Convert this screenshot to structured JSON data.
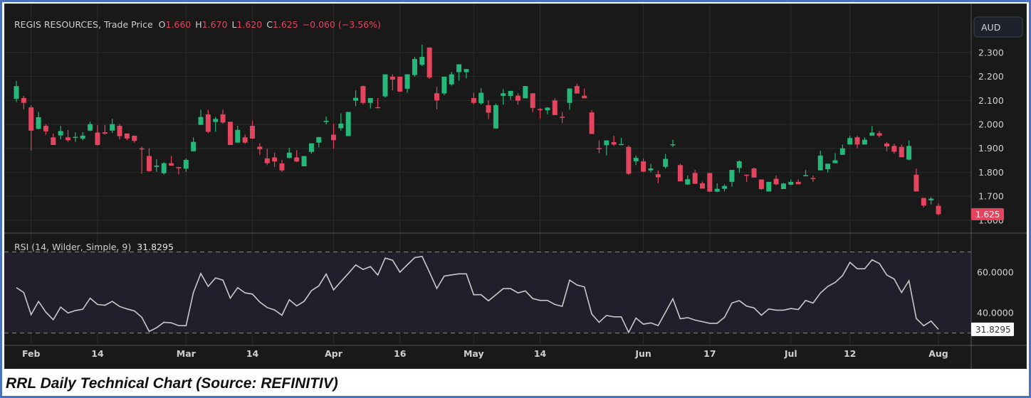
{
  "caption": "RRL Daily Technical Chart (Source: REFINITIV)",
  "colors": {
    "up": "#26b77a",
    "down": "#e4455e",
    "background": "#191919",
    "rsi_band": "#231e2b",
    "rsi_line": "#c9c9c9",
    "grid": "#2b2b2b"
  },
  "chart_data": [
    {
      "type": "candlestick",
      "title": "REGIS RESOURCES, Trade Price",
      "legend": {
        "o_label": "O",
        "o": "1.660",
        "h_label": "H",
        "h": "1.670",
        "l_label": "L",
        "l": "1.620",
        "c_label": "C",
        "c": "1.625",
        "change": "−0.060 (−3.56%)"
      },
      "currency": "AUD",
      "ylim": [
        1.549,
        2.466
      ],
      "yticks": [
        2.3,
        2.2,
        2.1,
        2.0,
        1.9,
        1.8,
        1.7,
        1.6
      ],
      "ytick_labels": [
        "2.300",
        "2.200",
        "2.100",
        "2.000",
        "1.900",
        "1.800",
        "1.700",
        "1.600"
      ],
      "last_price_label": "1.625",
      "x_ticks": [
        {
          "index": 2,
          "label": "Feb"
        },
        {
          "index": 11,
          "label": "14"
        },
        {
          "index": 23,
          "label": "Mar"
        },
        {
          "index": 32,
          "label": "14"
        },
        {
          "index": 43,
          "label": "Apr"
        },
        {
          "index": 52,
          "label": "16"
        },
        {
          "index": 62,
          "label": "May"
        },
        {
          "index": 71,
          "label": "14"
        },
        {
          "index": 85,
          "label": "Jun"
        },
        {
          "index": 94,
          "label": "17"
        },
        {
          "index": 105,
          "label": "Jul"
        },
        {
          "index": 113,
          "label": "12"
        },
        {
          "index": 125,
          "label": "Aug"
        }
      ],
      "ohlc_fields": [
        "open",
        "high",
        "low",
        "close"
      ],
      "ohlc": [
        [
          2.107,
          2.181,
          2.093,
          2.16
        ],
        [
          2.11,
          2.119,
          2.063,
          2.09
        ],
        [
          2.071,
          2.08,
          1.89,
          1.974
        ],
        [
          1.981,
          2.052,
          1.979,
          2.03
        ],
        [
          1.994,
          2.001,
          1.957,
          1.971
        ],
        [
          1.946,
          1.962,
          1.914,
          1.914
        ],
        [
          1.954,
          1.994,
          1.937,
          1.972
        ],
        [
          1.946,
          1.977,
          1.927,
          1.934
        ],
        [
          1.944,
          1.967,
          1.927,
          1.948
        ],
        [
          1.941,
          1.967,
          1.934,
          1.953
        ],
        [
          1.974,
          2.011,
          1.972,
          2.001
        ],
        [
          1.966,
          1.997,
          1.912,
          1.914
        ],
        [
          1.967,
          1.997,
          1.957,
          1.961
        ],
        [
          1.974,
          2.023,
          1.964,
          2.001
        ],
        [
          1.994,
          2.001,
          1.937,
          1.951
        ],
        [
          1.962,
          1.962,
          1.934,
          1.941
        ],
        [
          1.953,
          1.953,
          1.924,
          1.931
        ],
        [
          1.9,
          1.907,
          1.794,
          1.896
        ],
        [
          1.868,
          1.9,
          1.802,
          1.805
        ],
        [
          1.823,
          1.855,
          1.802,
          1.828
        ],
        [
          1.796,
          1.842,
          1.791,
          1.838
        ],
        [
          1.838,
          1.868,
          1.828,
          1.828
        ],
        [
          1.822,
          1.822,
          1.791,
          1.817
        ],
        [
          1.815,
          1.858,
          1.802,
          1.852
        ],
        [
          1.888,
          1.946,
          1.888,
          1.927
        ],
        [
          1.998,
          2.061,
          1.997,
          2.031
        ],
        [
          2.042,
          2.061,
          1.964,
          1.969
        ],
        [
          2.01,
          2.031,
          1.969,
          2.023
        ],
        [
          2.042,
          2.061,
          2.003,
          2.008
        ],
        [
          2.011,
          2.011,
          1.914,
          1.914
        ],
        [
          1.924,
          1.994,
          1.924,
          1.977
        ],
        [
          1.946,
          1.957,
          1.919,
          1.924
        ],
        [
          1.994,
          2.016,
          1.939,
          1.941
        ],
        [
          1.907,
          1.921,
          1.872,
          1.896
        ],
        [
          1.858,
          1.898,
          1.83,
          1.838
        ],
        [
          1.862,
          1.882,
          1.822,
          1.845
        ],
        [
          1.837,
          1.852,
          1.802,
          1.808
        ],
        [
          1.86,
          1.902,
          1.858,
          1.882
        ],
        [
          1.862,
          1.892,
          1.842,
          1.845
        ],
        [
          1.825,
          1.868,
          1.825,
          1.868
        ],
        [
          1.885,
          1.921,
          1.878,
          1.921
        ],
        [
          1.924,
          1.947,
          1.904,
          1.947
        ],
        [
          2.01,
          2.033,
          2.0,
          2.015
        ],
        [
          1.957,
          2.003,
          1.898,
          1.934
        ],
        [
          1.984,
          2.046,
          1.974,
          2.003
        ],
        [
          1.951,
          2.052,
          1.951,
          2.052
        ],
        [
          2.099,
          2.142,
          2.076,
          2.111
        ],
        [
          2.16,
          2.162,
          2.083,
          2.09
        ],
        [
          2.09,
          2.11,
          2.066,
          2.11
        ],
        [
          2.072,
          2.11,
          2.07,
          2.07
        ],
        [
          2.117,
          2.209,
          2.112,
          2.209
        ],
        [
          2.199,
          2.209,
          2.142,
          2.187
        ],
        [
          2.199,
          2.199,
          2.137,
          2.137
        ],
        [
          2.149,
          2.209,
          2.132,
          2.209
        ],
        [
          2.206,
          2.281,
          2.199,
          2.273
        ],
        [
          2.249,
          2.333,
          2.243,
          2.282
        ],
        [
          2.321,
          2.321,
          2.19,
          2.196
        ],
        [
          2.13,
          2.157,
          2.063,
          2.1
        ],
        [
          2.129,
          2.199,
          2.122,
          2.199
        ],
        [
          2.167,
          2.219,
          2.162,
          2.209
        ],
        [
          2.218,
          2.251,
          2.182,
          2.251
        ],
        [
          2.218,
          2.231,
          2.192,
          2.231
        ],
        [
          2.11,
          2.132,
          2.083,
          2.09
        ],
        [
          2.088,
          2.152,
          2.083,
          2.132
        ],
        [
          2.08,
          2.1,
          2.022,
          2.049
        ],
        [
          1.983,
          2.087,
          1.983,
          2.08
        ],
        [
          2.119,
          2.147,
          2.082,
          2.13
        ],
        [
          2.119,
          2.14,
          2.102,
          2.14
        ],
        [
          2.12,
          2.13,
          2.082,
          2.099
        ],
        [
          2.109,
          2.16,
          2.109,
          2.16
        ],
        [
          2.13,
          2.13,
          2.052,
          2.069
        ],
        [
          2.064,
          2.069,
          2.025,
          2.061
        ],
        [
          2.059,
          2.072,
          2.042,
          2.07
        ],
        [
          2.1,
          2.109,
          2.039,
          2.039
        ],
        [
          2.032,
          2.052,
          2.005,
          2.029
        ],
        [
          2.09,
          2.15,
          2.062,
          2.15
        ],
        [
          2.16,
          2.17,
          2.129,
          2.129
        ],
        [
          2.12,
          2.15,
          2.109,
          2.109
        ],
        [
          2.05,
          2.06,
          1.96,
          1.96
        ],
        [
          1.901,
          1.933,
          1.88,
          1.898
        ],
        [
          1.913,
          1.933,
          1.87,
          1.933
        ],
        [
          1.926,
          1.953,
          1.91,
          1.916
        ],
        [
          1.917,
          1.943,
          1.916,
          1.918
        ],
        [
          1.906,
          1.913,
          1.789,
          1.794
        ],
        [
          1.846,
          1.87,
          1.83,
          1.86
        ],
        [
          1.846,
          1.858,
          1.8,
          1.803
        ],
        [
          1.808,
          1.836,
          1.8,
          1.816
        ],
        [
          1.792,
          1.808,
          1.754,
          1.779
        ],
        [
          1.823,
          1.876,
          1.816,
          1.856
        ],
        [
          1.915,
          1.936,
          1.906,
          1.917
        ],
        [
          1.83,
          1.836,
          1.762,
          1.762
        ],
        [
          1.749,
          1.787,
          1.747,
          1.771
        ],
        [
          1.797,
          1.81,
          1.752,
          1.752
        ],
        [
          1.754,
          1.761,
          1.732,
          1.732
        ],
        [
          1.797,
          1.797,
          1.719,
          1.719
        ],
        [
          1.719,
          1.754,
          1.717,
          1.731
        ],
        [
          1.731,
          1.75,
          1.72,
          1.743
        ],
        [
          1.76,
          1.81,
          1.74,
          1.81
        ],
        [
          1.818,
          1.85,
          1.798,
          1.846
        ],
        [
          1.79,
          1.79,
          1.76,
          1.786
        ],
        [
          1.816,
          1.82,
          1.778,
          1.778
        ],
        [
          1.77,
          1.77,
          1.726,
          1.73
        ],
        [
          1.72,
          1.76,
          1.72,
          1.76
        ],
        [
          1.773,
          1.786,
          1.746,
          1.75
        ],
        [
          1.73,
          1.756,
          1.73,
          1.753
        ],
        [
          1.748,
          1.77,
          1.746,
          1.76
        ],
        [
          1.76,
          1.77,
          1.75,
          1.75
        ],
        [
          1.784,
          1.81,
          1.784,
          1.788
        ],
        [
          1.776,
          1.786,
          1.76,
          1.772
        ],
        [
          1.808,
          1.89,
          1.808,
          1.87
        ],
        [
          1.813,
          1.836,
          1.8,
          1.836
        ],
        [
          1.838,
          1.88,
          1.838,
          1.85
        ],
        [
          1.873,
          1.916,
          1.873,
          1.9
        ],
        [
          1.916,
          1.953,
          1.916,
          1.943
        ],
        [
          1.946,
          1.953,
          1.9,
          1.916
        ],
        [
          1.916,
          1.946,
          1.916,
          1.936
        ],
        [
          1.953,
          1.993,
          1.953,
          1.966
        ],
        [
          1.963,
          1.973,
          1.946,
          1.953
        ],
        [
          1.92,
          1.926,
          1.888,
          1.908
        ],
        [
          1.91,
          1.92,
          1.878,
          1.886
        ],
        [
          1.906,
          1.916,
          1.863,
          1.863
        ],
        [
          1.853,
          1.933,
          1.85,
          1.91
        ],
        [
          1.79,
          1.816,
          1.72,
          1.72
        ],
        [
          1.693,
          1.693,
          1.653,
          1.661
        ],
        [
          1.683,
          1.696,
          1.666,
          1.69
        ],
        [
          1.66,
          1.67,
          1.62,
          1.625
        ]
      ]
    },
    {
      "type": "line",
      "title": "RSI (14, Wilder, Simple, 9)",
      "current_value": "31.8295",
      "ylim": [
        23.9,
        78.6
      ],
      "bands": [
        30,
        70
      ],
      "yticks": [
        60,
        40
      ],
      "ytick_labels": [
        "60.0000",
        "40.0000"
      ],
      "values": [
        52.4,
        50.0,
        39.1,
        45.6,
        40.3,
        36.6,
        42.8,
        39.9,
        41.1,
        41.7,
        47.2,
        44.1,
        43.7,
        45.6,
        43.1,
        41.9,
        40.9,
        37.8,
        30.8,
        32.6,
        35.3,
        35.0,
        33.7,
        33.6,
        50.0,
        59.4,
        53.0,
        57.2,
        56.1,
        47.2,
        52.4,
        49.8,
        49.2,
        45.3,
        42.6,
        41.4,
        38.8,
        46.4,
        43.4,
        45.6,
        50.9,
        53.3,
        59.1,
        51.3,
        55.4,
        59.4,
        63.6,
        61.4,
        62.8,
        58.6,
        67.0,
        65.9,
        60.0,
        63.7,
        67.2,
        67.8,
        60.0,
        52.0,
        58.1,
        58.7,
        59.2,
        59.2,
        48.9,
        48.9,
        45.9,
        48.9,
        51.9,
        51.9,
        49.8,
        50.8,
        47.0,
        46.1,
        46.1,
        44.1,
        43.2,
        56.1,
        53.7,
        52.8,
        39.4,
        35.3,
        38.7,
        38.0,
        38.0,
        30.3,
        37.4,
        34.4,
        35.0,
        33.7,
        40.3,
        46.9,
        37.1,
        37.6,
        36.4,
        35.6,
        34.8,
        34.8,
        37.8,
        44.8,
        46.0,
        43.3,
        42.4,
        38.8,
        41.9,
        41.3,
        41.3,
        42.1,
        41.6,
        46.1,
        44.8,
        49.7,
        53.0,
        55.0,
        58.3,
        64.9,
        61.7,
        61.7,
        66.1,
        64.3,
        58.6,
        56.7,
        50.0,
        55.8,
        37.2,
        33.6,
        35.9,
        31.8295
      ]
    }
  ]
}
